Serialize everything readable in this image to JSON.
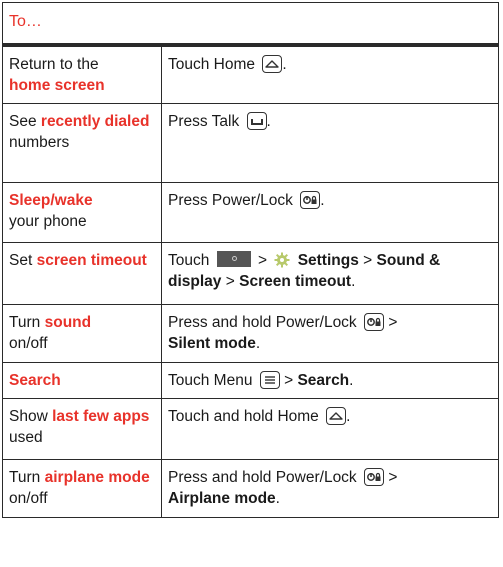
{
  "header": {
    "label": "To…"
  },
  "rows": [
    {
      "task": [
        "Return to the",
        "home screen"
      ],
      "action": [
        "Touch Home",
        "."
      ]
    },
    {
      "task": [
        "See",
        "recently dialed",
        "numbers"
      ],
      "action": [
        "Press Talk",
        "."
      ]
    },
    {
      "task": [
        "Sleep/wake",
        "your phone"
      ],
      "action": [
        "Press Power/Lock",
        "."
      ]
    },
    {
      "task": [
        "Set",
        "screen timeout"
      ],
      "action": [
        "Touch",
        ">",
        "Settings",
        ">",
        "Sound & display",
        ">",
        "Screen timeout",
        "."
      ]
    },
    {
      "task": [
        "Turn",
        "sound",
        "on/off"
      ],
      "action": [
        "Press and hold Power/Lock",
        ">",
        "Silent mode",
        "."
      ]
    },
    {
      "task": [
        "Search"
      ],
      "action": [
        "Touch Menu",
        ">",
        "Search",
        "."
      ]
    },
    {
      "task": [
        "Show",
        "last few apps",
        "used"
      ],
      "action": [
        "Touch and hold Home",
        "."
      ]
    },
    {
      "task": [
        "Turn",
        "airplane mode",
        "on/off"
      ],
      "action": [
        "Press and hold Power/Lock",
        ">",
        "Airplane mode",
        "."
      ]
    }
  ],
  "icons": {
    "home": "home-key-icon",
    "talk": "talk-key-icon",
    "power": "power-lock-key-icon",
    "menu": "menu-key-icon",
    "settings": "settings-gear-icon",
    "home_tile": "home-screen-tile-icon"
  },
  "colors": {
    "accent": "#e8322a",
    "text": "#1a1a1a",
    "border": "#2a2a2a"
  }
}
